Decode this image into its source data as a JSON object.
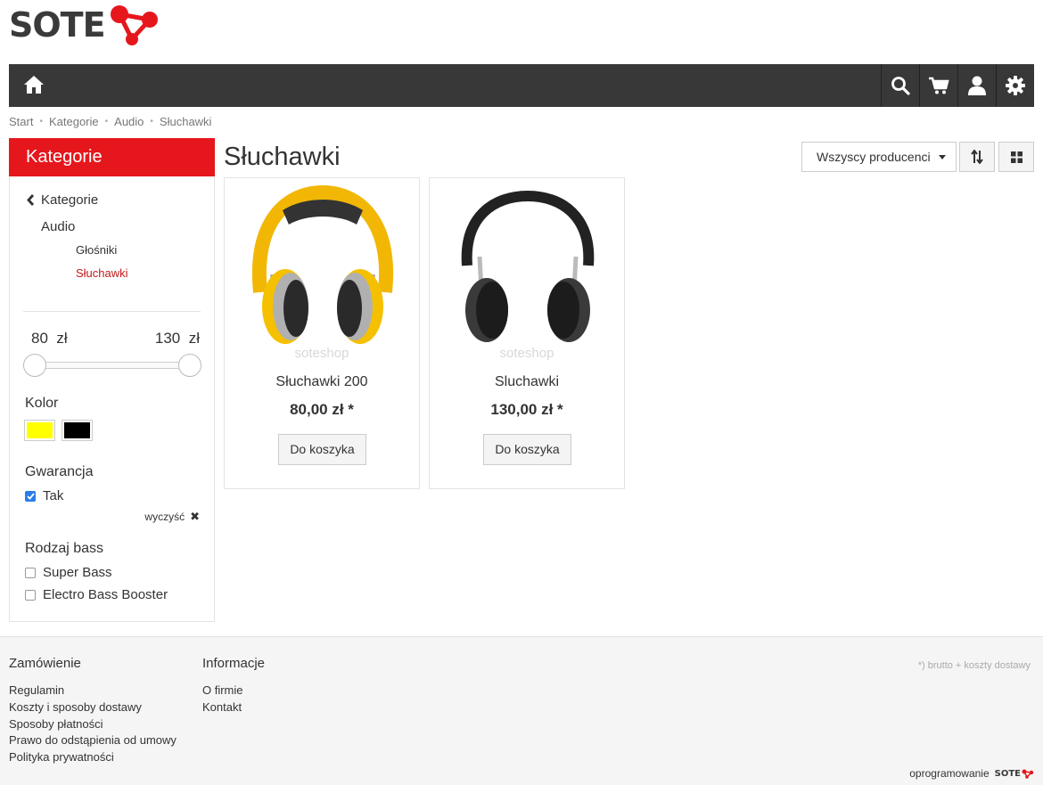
{
  "logo": {
    "text": "SOTE"
  },
  "breadcrumb": [
    "Start",
    "Kategorie",
    "Audio",
    "Słuchawki"
  ],
  "sidebar": {
    "title": "Kategorie",
    "back_label": "Kategorie",
    "category": "Audio",
    "subcategories": [
      "Głośniki",
      "Słuchawki"
    ],
    "price_min": "80",
    "price_max": "130",
    "currency": "zł",
    "color_title": "Kolor",
    "colors": [
      "#ffff00",
      "#000000"
    ],
    "guarantee_title": "Gwarancja",
    "guarantee_option": "Tak",
    "clear_label": "wyczyść",
    "bass_title": "Rodzaj bass",
    "bass_options": [
      "Super Bass",
      "Electro Bass Booster"
    ],
    "accent": "#e5171d"
  },
  "main": {
    "title": "Słuchawki",
    "producer_select": "Wszyscy producenci",
    "watermark": "soteshop",
    "products": [
      {
        "name": "Słuchawki 200",
        "price": "80,00 zł *",
        "button": "Do koszyka"
      },
      {
        "name": "Sluchawki",
        "price": "130,00 zł *",
        "button": "Do koszyka"
      }
    ]
  },
  "footer": {
    "col1_title": "Zamówienie",
    "col1_links": [
      "Regulamin",
      "Koszty i sposoby dostawy",
      "Sposoby płatności",
      "Prawo do odstąpienia od umowy",
      "Polityka prywatności"
    ],
    "col2_title": "Informacje",
    "col2_links": [
      "O firmie",
      "Kontakt"
    ],
    "note": "*) brutto + koszty dostawy",
    "credits": "oprogramowanie",
    "credits_logo": "SOTE"
  }
}
